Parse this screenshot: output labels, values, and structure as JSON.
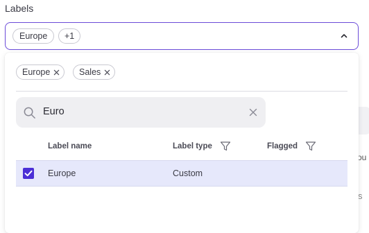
{
  "field": {
    "label": "Labels",
    "chips": [
      "Europe",
      "+1"
    ]
  },
  "background": {
    "text_1": "ou",
    "text_2": "s"
  },
  "dropdown": {
    "selected_chips": [
      "Europe",
      "Sales"
    ],
    "search": {
      "value": "Euro"
    },
    "table": {
      "headers": {
        "name": "Label name",
        "type": "Label type",
        "flagged": "Flagged"
      },
      "rows": [
        {
          "name": "Europe",
          "type": "Custom",
          "flagged": "",
          "checked": true
        }
      ]
    }
  },
  "colors": {
    "accent": "#4b2fd6",
    "focus_border": "#6a4bd8",
    "row_highlight": "#e6e8fb"
  }
}
